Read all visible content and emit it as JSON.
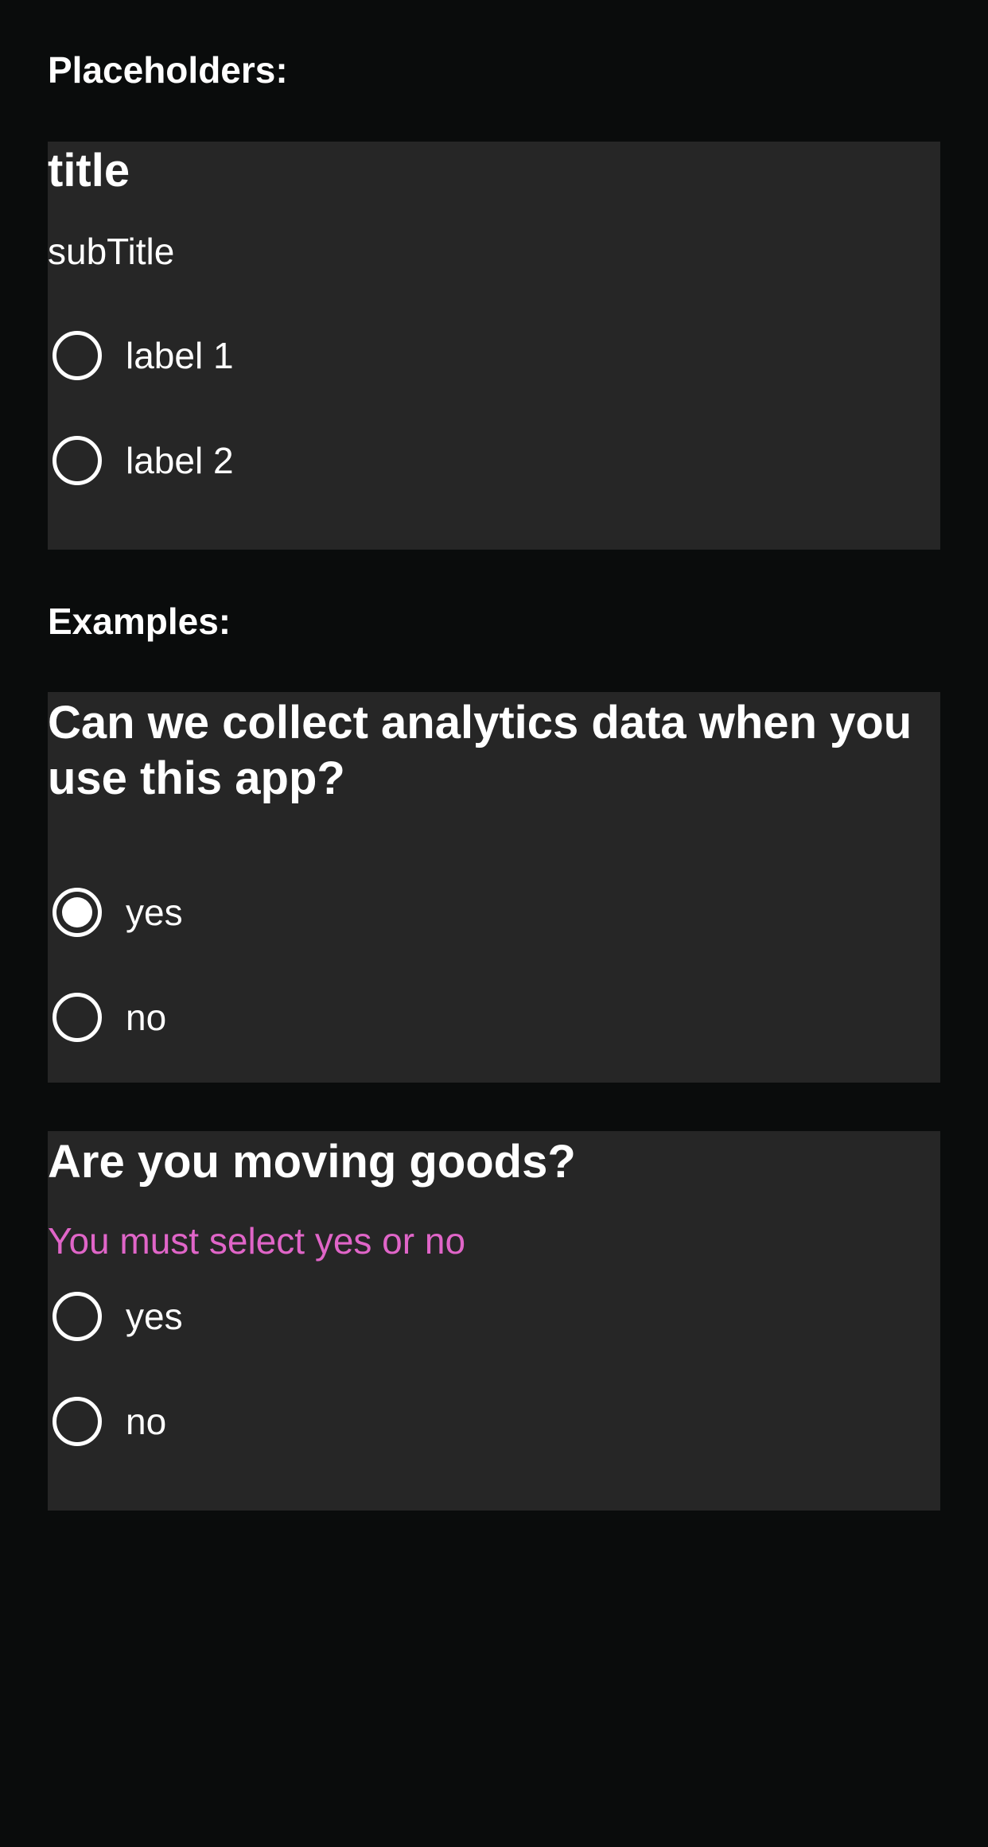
{
  "colors": {
    "background": "#0a0c0c",
    "card": "#262626",
    "text": "#ffffff",
    "error": "#e065c8"
  },
  "placeholders": {
    "heading": "Placeholders:",
    "title": "title",
    "subtitle": "subTitle",
    "options": [
      {
        "label": "label 1",
        "checked": false
      },
      {
        "label": "label 2",
        "checked": false
      }
    ]
  },
  "examples": {
    "heading": "Examples:",
    "analytics": {
      "title": "Can we collect analytics data when you use this app?",
      "options": [
        {
          "label": "yes",
          "checked": true
        },
        {
          "label": "no",
          "checked": false
        }
      ]
    },
    "moving_goods": {
      "title": "Are you moving goods?",
      "error": "You must select yes or no",
      "options": [
        {
          "label": "yes",
          "checked": false
        },
        {
          "label": "no",
          "checked": false
        }
      ]
    }
  }
}
